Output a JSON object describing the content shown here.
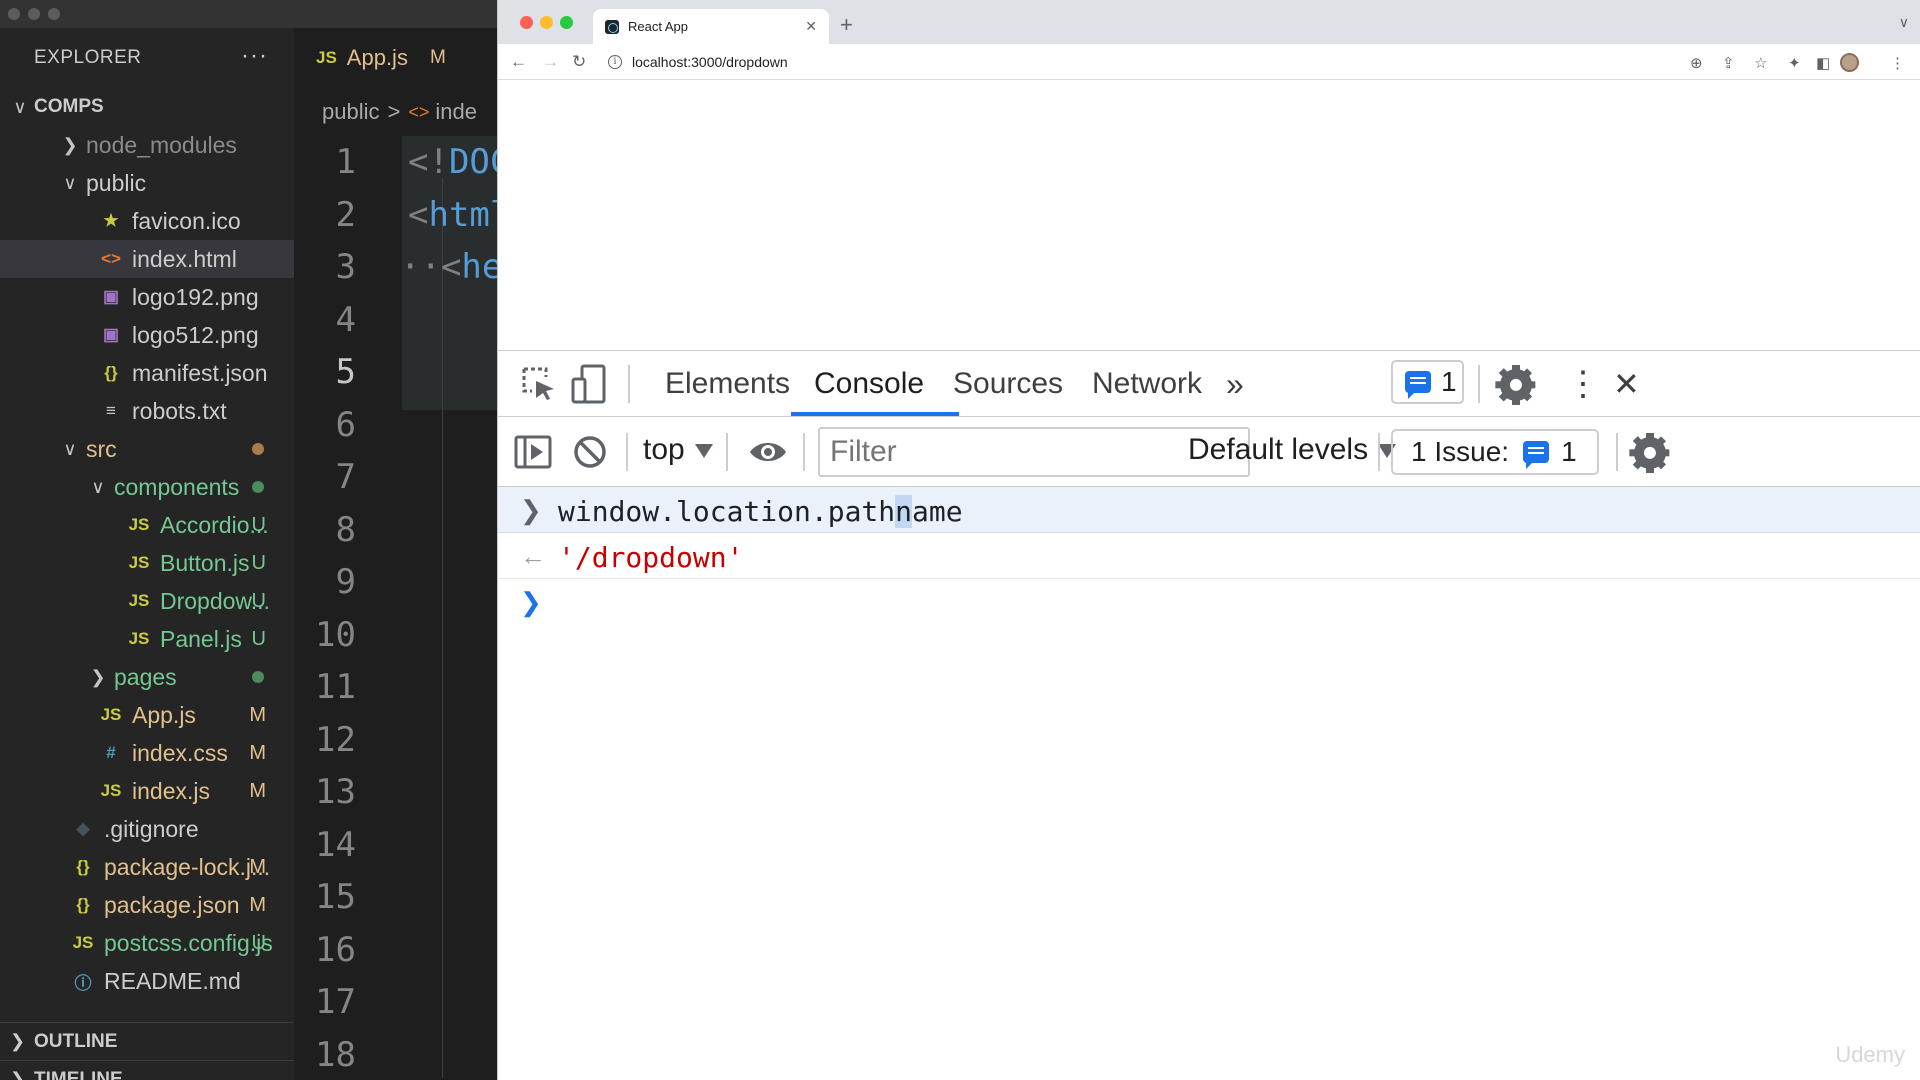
{
  "vscode": {
    "explorer_title": "EXPLORER",
    "more_label": "···",
    "tree": [
      {
        "label": "COMPS",
        "kind": "root",
        "expanded": true
      },
      {
        "label": "node_modules",
        "kind": "folder",
        "expanded": false,
        "color": "#8b8b8b"
      },
      {
        "label": "public",
        "kind": "folder",
        "expanded": true
      },
      {
        "label": "favicon.ico",
        "kind": "file",
        "icon": "star-icon",
        "glyph": "★",
        "iconColor": "#cbcb41"
      },
      {
        "label": "index.html",
        "kind": "file",
        "icon": "html-icon",
        "glyph": "<>",
        "iconColor": "#e37933",
        "selected": true
      },
      {
        "label": "logo192.png",
        "kind": "file",
        "icon": "image-icon",
        "glyph": "▣",
        "iconColor": "#a074c4"
      },
      {
        "label": "logo512.png",
        "kind": "file",
        "icon": "image-icon",
        "glyph": "▣",
        "iconColor": "#a074c4"
      },
      {
        "label": "manifest.json",
        "kind": "file",
        "icon": "json-icon",
        "glyph": "{}",
        "iconColor": "#cbcb41"
      },
      {
        "label": "robots.txt",
        "kind": "file",
        "icon": "text-icon",
        "glyph": "≡",
        "iconColor": "#c5c5c5"
      },
      {
        "label": "src",
        "kind": "folder",
        "expanded": true,
        "color": "#e2c08d",
        "dot": "#a77d4b"
      },
      {
        "label": "components",
        "kind": "folder",
        "expanded": true,
        "color": "#73c991",
        "dot": "#4d8a5e"
      },
      {
        "label": "Accordio...",
        "kind": "file",
        "icon": "js-icon",
        "glyph": "JS",
        "iconColor": "#cbcb41",
        "color": "#73c991",
        "badge": "U"
      },
      {
        "label": "Button.js",
        "kind": "file",
        "icon": "js-icon",
        "glyph": "JS",
        "iconColor": "#cbcb41",
        "color": "#73c991",
        "badge": "U"
      },
      {
        "label": "Dropdow...",
        "kind": "file",
        "icon": "js-icon",
        "glyph": "JS",
        "iconColor": "#cbcb41",
        "color": "#73c991",
        "badge": "U"
      },
      {
        "label": "Panel.js",
        "kind": "file",
        "icon": "js-icon",
        "glyph": "JS",
        "iconColor": "#cbcb41",
        "color": "#73c991",
        "badge": "U"
      },
      {
        "label": "pages",
        "kind": "folder",
        "expanded": false,
        "color": "#73c991",
        "dot": "#4d8a5e"
      },
      {
        "label": "App.js",
        "kind": "file",
        "icon": "js-icon",
        "glyph": "JS",
        "iconColor": "#cbcb41",
        "color": "#e2c08d",
        "badge": "M"
      },
      {
        "label": "index.css",
        "kind": "file",
        "icon": "css-icon",
        "glyph": "#",
        "iconColor": "#519aba",
        "color": "#e2c08d",
        "badge": "M"
      },
      {
        "label": "index.js",
        "kind": "file",
        "icon": "js-icon",
        "glyph": "JS",
        "iconColor": "#cbcb41",
        "color": "#e2c08d",
        "badge": "M"
      },
      {
        "label": ".gitignore",
        "kind": "file",
        "icon": "git-icon",
        "glyph": "◆",
        "iconColor": "#41535b"
      },
      {
        "label": "package-lock.j...",
        "kind": "file",
        "icon": "json-icon",
        "glyph": "{}",
        "iconColor": "#cbcb41",
        "color": "#e2c08d",
        "badge": "M"
      },
      {
        "label": "package.json",
        "kind": "file",
        "icon": "json-icon",
        "glyph": "{}",
        "iconColor": "#cbcb41",
        "color": "#e2c08d",
        "badge": "M"
      },
      {
        "label": "postcss.config.js",
        "kind": "file",
        "icon": "js-icon",
        "glyph": "JS",
        "iconColor": "#cbcb41",
        "color": "#73c991",
        "badge": "U"
      },
      {
        "label": "README.md",
        "kind": "file",
        "icon": "info-icon",
        "glyph": "ⓘ",
        "iconColor": "#519aba"
      }
    ],
    "sections": [
      "OUTLINE",
      "TIMELINE"
    ],
    "editor_tab": {
      "label": "App.js",
      "badge": "M",
      "icon_text": "JS"
    },
    "breadcrumb": {
      "folder": "public",
      "file": "inde"
    },
    "line_numbers": [
      "1",
      "2",
      "3",
      "4",
      "5",
      "6",
      "7",
      "8",
      "9",
      "10",
      "11",
      "12",
      "13",
      "14",
      "15",
      "16",
      "17",
      "18"
    ],
    "current_line": "5",
    "code_line_1": "<!DOC",
    "code_line_2": "<html",
    "code_line_3": "··<he"
  },
  "browser": {
    "tab_title": "React App",
    "url": "localhost:3000/dropdown",
    "devtools": {
      "tabs": [
        "Elements",
        "Console",
        "Sources",
        "Network"
      ],
      "active_tab": "Console",
      "issues_count": "1",
      "context": "top",
      "filter_placeholder": "Filter",
      "levels": "Default levels",
      "issue_summary": "1 Issue:",
      "issue_summary_count": "1",
      "console": {
        "input_before": "window.location.path",
        "input_selected": "n",
        "input_after": "ame",
        "output": "'/dropdown'"
      }
    }
  },
  "watermark": "Udemy"
}
